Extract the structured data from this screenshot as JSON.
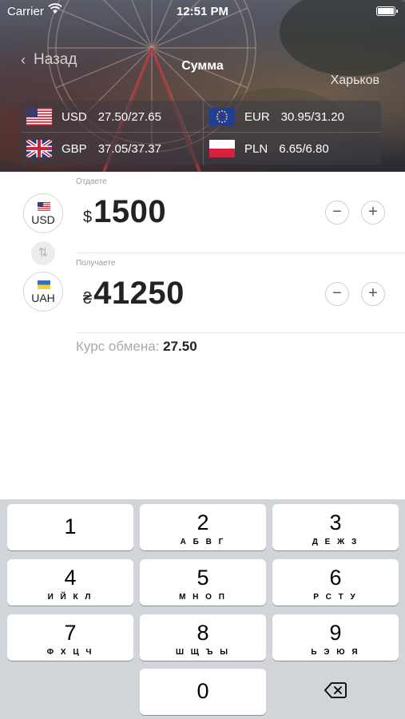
{
  "status_bar": {
    "carrier": "Carrier",
    "time": "12:51 PM"
  },
  "nav": {
    "back_label": "Назад",
    "title": "Сумма",
    "city": "Харьков"
  },
  "rates": [
    {
      "code": "USD",
      "rate": "27.50/27.65",
      "flag": "us-flag-icon"
    },
    {
      "code": "EUR",
      "rate": "30.95/31.20",
      "flag": "eu-flag-icon"
    },
    {
      "code": "GBP",
      "rate": "37.05/37.37",
      "flag": "uk-flag-icon"
    },
    {
      "code": "PLN",
      "rate": "6.65/6.80",
      "flag": "pl-flag-icon"
    }
  ],
  "converter": {
    "give": {
      "label": "Отдаете",
      "currency": "USD",
      "symbol": "$",
      "amount": "1500"
    },
    "receive": {
      "label": "Получаете",
      "currency": "UAH",
      "symbol": "₴",
      "amount": "41250"
    },
    "exchange_rate_label": "Курс обмена:",
    "exchange_rate_value": "27.50",
    "minus": "−",
    "plus": "+",
    "swap_icon": "swap-arrows-icon"
  },
  "keyboard": {
    "keys": [
      {
        "num": "1",
        "letters": ""
      },
      {
        "num": "2",
        "letters": "А Б В Г"
      },
      {
        "num": "3",
        "letters": "Д Е Ж З"
      },
      {
        "num": "4",
        "letters": "И Й К Л"
      },
      {
        "num": "5",
        "letters": "М Н О П"
      },
      {
        "num": "6",
        "letters": "Р С Т У"
      },
      {
        "num": "7",
        "letters": "Ф Х Ц Ч"
      },
      {
        "num": "8",
        "letters": "Ш Щ Ъ Ы"
      },
      {
        "num": "9",
        "letters": "Ь Э Ю Я"
      },
      {
        "num": "0",
        "letters": ""
      }
    ],
    "delete_icon": "backspace-icon"
  },
  "colors": {
    "keyboard_bg": "#d1d4d9",
    "key_bg": "#ffffff",
    "muted_text": "#a9a9a9"
  }
}
